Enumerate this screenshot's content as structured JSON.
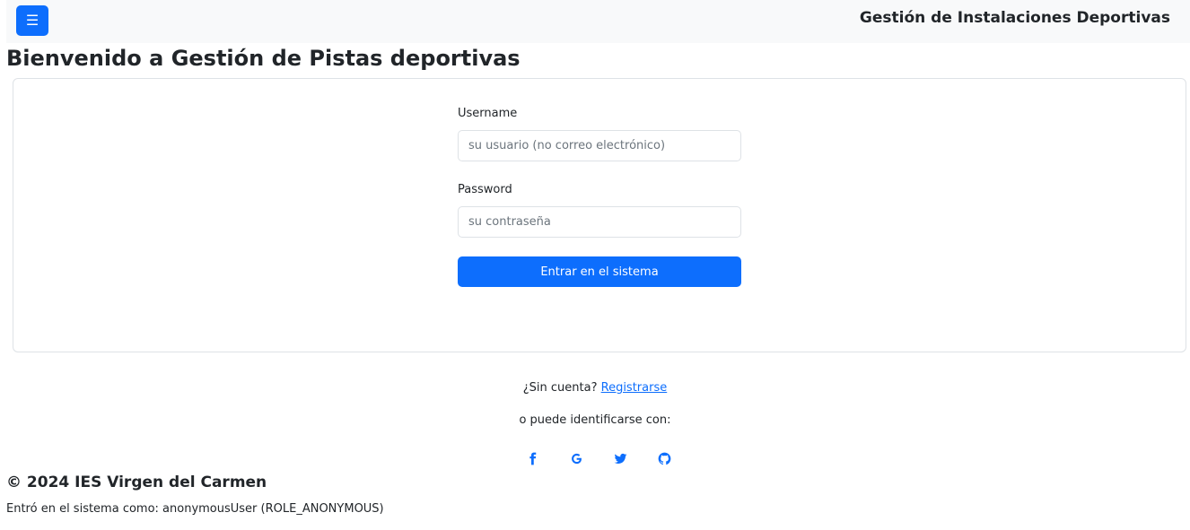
{
  "navbar": {
    "menu_icon": "☰",
    "brand": "Gestión de Instalaciones Deportivas"
  },
  "page": {
    "title": "Bienvenido a Gestión de Pistas deportivas"
  },
  "login_form": {
    "username_label": "Username",
    "username_placeholder": "su usuario (no correo electrónico)",
    "username_value": "",
    "password_label": "Password",
    "password_placeholder": "su contraseña",
    "password_value": "",
    "submit_label": "Entrar en el sistema"
  },
  "signup": {
    "prompt": "¿Sin cuenta?",
    "link_label": "Registrarse"
  },
  "social": {
    "prompt": "o puede identificarse con:",
    "providers": [
      "facebook-icon",
      "google-icon",
      "twitter-icon",
      "github-icon"
    ]
  },
  "footer": {
    "copyright": "© 2024 IES Virgen del Carmen",
    "session_info": "Entró en el sistema como: anonymousUser (ROLE_ANONYMOUS)"
  },
  "colors": {
    "primary": "#0d6efd",
    "navbar_bg": "#f8f9fa",
    "border": "#dee2e6",
    "text": "#212529"
  }
}
